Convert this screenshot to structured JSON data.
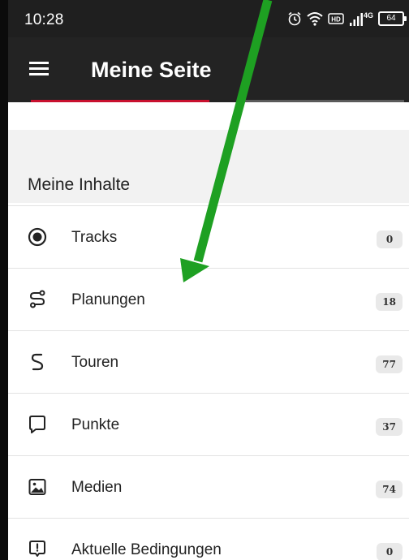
{
  "status_bar": {
    "time": "10:28",
    "network": "4G",
    "hd": "HD",
    "battery": "64"
  },
  "app_bar": {
    "title": "Meine Seite"
  },
  "section": {
    "title": "Meine Inhalte"
  },
  "items": [
    {
      "label": "Tracks",
      "count": "0",
      "icon": "record-icon"
    },
    {
      "label": "Planungen",
      "count": "18",
      "icon": "route-plan-icon"
    },
    {
      "label": "Touren",
      "count": "77",
      "icon": "tour-squiggle-icon"
    },
    {
      "label": "Punkte",
      "count": "37",
      "icon": "speech-bubble-icon"
    },
    {
      "label": "Medien",
      "count": "74",
      "icon": "image-icon"
    },
    {
      "label": "Aktuelle Bedingungen",
      "count": "0",
      "icon": "alert-bubble-icon"
    }
  ],
  "colors": {
    "status_bar": "#1f1f1f",
    "app_bar": "#232323",
    "active_tab": "#c8102e",
    "arrow": "#1ea022",
    "badge_bg": "#e9e9e9"
  }
}
